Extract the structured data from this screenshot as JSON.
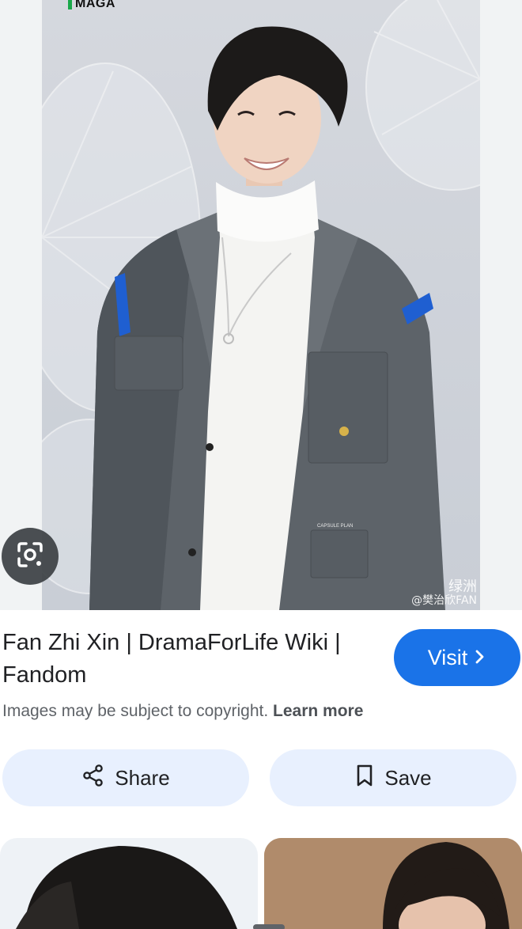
{
  "image": {
    "brand_logo_text": "MAGA",
    "watermark_line1": "绿洲",
    "watermark_line2": "@樊治欣FAN",
    "jacket_label": "CAPSULE PLAN"
  },
  "result": {
    "title": "Fan Zhi Xin | DramaForLife Wiki | Fandom",
    "visit_label": "Visit",
    "copyright_text": "Images may be subject to copyright.",
    "learn_more_label": "Learn more"
  },
  "actions": {
    "share_label": "Share",
    "save_label": "Save"
  },
  "icons": {
    "lens": "lens-icon",
    "visit_arrow": "chevron-right-icon",
    "share": "share-icon",
    "save": "bookmark-icon"
  },
  "colors": {
    "accent": "#1a73e8",
    "pill_background": "#e8f0fe",
    "text_primary": "#202124",
    "text_secondary": "#5f6368"
  }
}
